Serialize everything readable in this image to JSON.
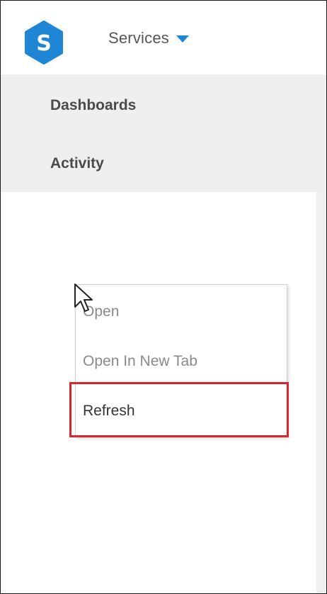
{
  "header": {
    "logo_letter": "S",
    "services_label": "Services"
  },
  "nav": {
    "items": [
      {
        "label": "Dashboards"
      },
      {
        "label": "Activity"
      }
    ]
  },
  "context_menu": {
    "items": [
      {
        "label": "Open"
      },
      {
        "label": "Open In New Tab"
      },
      {
        "label": "Refresh"
      }
    ]
  },
  "colors": {
    "brand": "#1f86d6",
    "highlight": "#d7262d"
  },
  "icons": {
    "logo": "hexagon-s-logo",
    "dropdown": "caret-down-icon",
    "cursor": "mouse-pointer-icon"
  }
}
